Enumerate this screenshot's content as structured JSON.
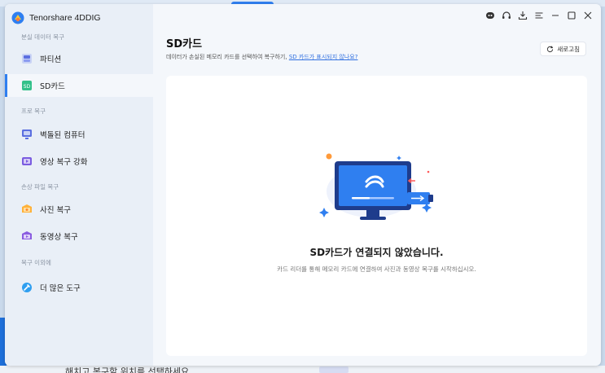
{
  "app": {
    "name": "Tenorshare 4DDIG"
  },
  "sidebar": {
    "sections": [
      {
        "label": "분실 데이터 복구"
      },
      {
        "label": "프로 복구"
      },
      {
        "label": "손상 파일 복구"
      },
      {
        "label": "복구 이외에"
      }
    ],
    "items": [
      {
        "label": "파티션",
        "icon": "partition-icon"
      },
      {
        "label": "SD카드",
        "icon": "sd-card-icon"
      },
      {
        "label": "벽돌된 컴퓨터",
        "icon": "crashed-computer-icon"
      },
      {
        "label": "영상 복구 강화",
        "icon": "video-enhance-icon"
      },
      {
        "label": "사진 복구",
        "icon": "photo-icon"
      },
      {
        "label": "동영상 복구",
        "icon": "video-icon"
      },
      {
        "label": "더 많은 도구",
        "icon": "tools-icon"
      }
    ]
  },
  "main": {
    "title": "SD카드",
    "description": "데이터가 손실된 메모리 카드를 선택하여 복구하기, ",
    "description_link": "SD 카드가 표시되지 않나요?",
    "refresh_label": "새로고침",
    "empty_title": "SD카드가 연결되지 않았습니다.",
    "empty_desc": "카드 리더를 통해 메모리 카드에 연결하여 사진과 동영상 복구를 시작하십시오."
  },
  "background": {
    "bottom_text": "해치고 복구할 위치를 선택하세요"
  },
  "colors": {
    "accent": "#2f7ff0",
    "sidebar_bg": "#e9eff7",
    "card_bg": "#ffffff"
  }
}
